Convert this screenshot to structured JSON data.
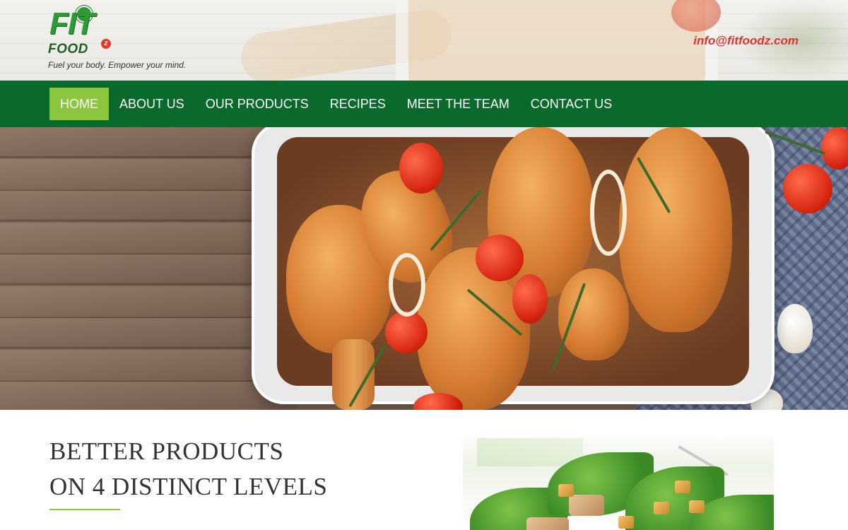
{
  "header": {
    "logo": {
      "word_fit": "FIT",
      "word_food": "FOOD",
      "superscript": "z",
      "tagline": "Fuel your body. Empower your mind."
    },
    "email": "info@fitfoodz.com"
  },
  "nav": {
    "items": [
      {
        "label": "HOME",
        "active": true
      },
      {
        "label": "ABOUT US",
        "active": false
      },
      {
        "label": "OUR PRODUCTS",
        "active": false
      },
      {
        "label": "RECIPES",
        "active": false
      },
      {
        "label": "MEET THE TEAM",
        "active": false
      },
      {
        "label": "CONTACT US",
        "active": false
      }
    ]
  },
  "hero": {
    "image": "roasted-chicken-drumsticks-in-baking-dish"
  },
  "content": {
    "headline_line1": "BETTER PRODUCTS",
    "headline_line2": "ON 4 DISTINCT LEVELS",
    "image": "caesar-salad"
  },
  "colors": {
    "nav_bg": "#096a2c",
    "nav_active": "#8cc63e",
    "email": "#e0332d",
    "logo_green": "#2e9a35",
    "divider": "#8cc63e"
  }
}
